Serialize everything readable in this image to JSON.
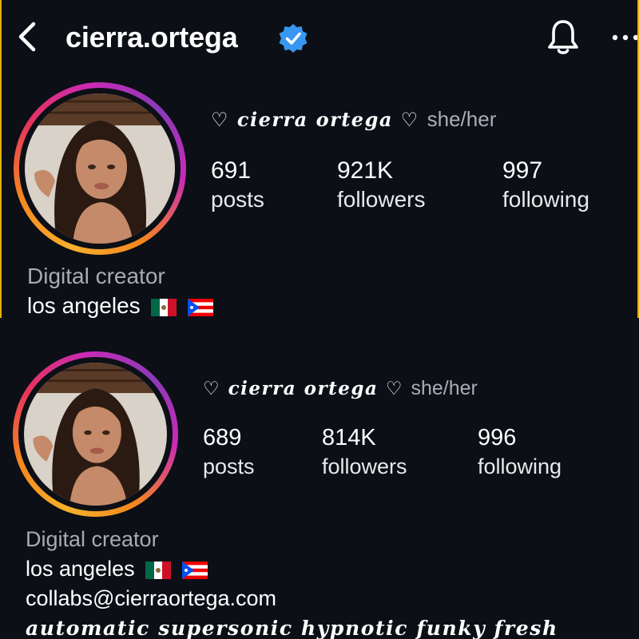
{
  "header": {
    "username": "cierra.ortega",
    "back_icon": "chevron-left-icon",
    "verified_icon": "verified-badge-icon",
    "bell_icon": "bell-icon",
    "more_icon": "more-horizontal-icon"
  },
  "colors": {
    "background": "#0c0f16",
    "verified": "#3897f0",
    "ring_start": "#f7b02c",
    "ring_end": "#c92bb7",
    "muted_text": "#a7abb2"
  },
  "top": {
    "display_name": "♡ cierra ortega ♡",
    "pronouns": "she/her",
    "stats": [
      {
        "value": "691",
        "label": "posts"
      },
      {
        "value": "921K",
        "label": "followers"
      },
      {
        "value": "997",
        "label": "following"
      }
    ],
    "category": "Digital creator",
    "location": "los angeles",
    "flags": [
      "mexico-flag",
      "puerto-rico-flag"
    ]
  },
  "bottom": {
    "display_name": "♡ cierra ortega ♡",
    "pronouns": "she/her",
    "stats": [
      {
        "value": "689",
        "label": "posts"
      },
      {
        "value": "814K",
        "label": "followers"
      },
      {
        "value": "996",
        "label": "following"
      }
    ],
    "category": "Digital creator",
    "location": "los angeles",
    "flags": [
      "mexico-flag",
      "puerto-rico-flag"
    ],
    "email": "collabs@cierraortega.com",
    "tagline": "automatic supersonic hypnotic funky fresh"
  }
}
